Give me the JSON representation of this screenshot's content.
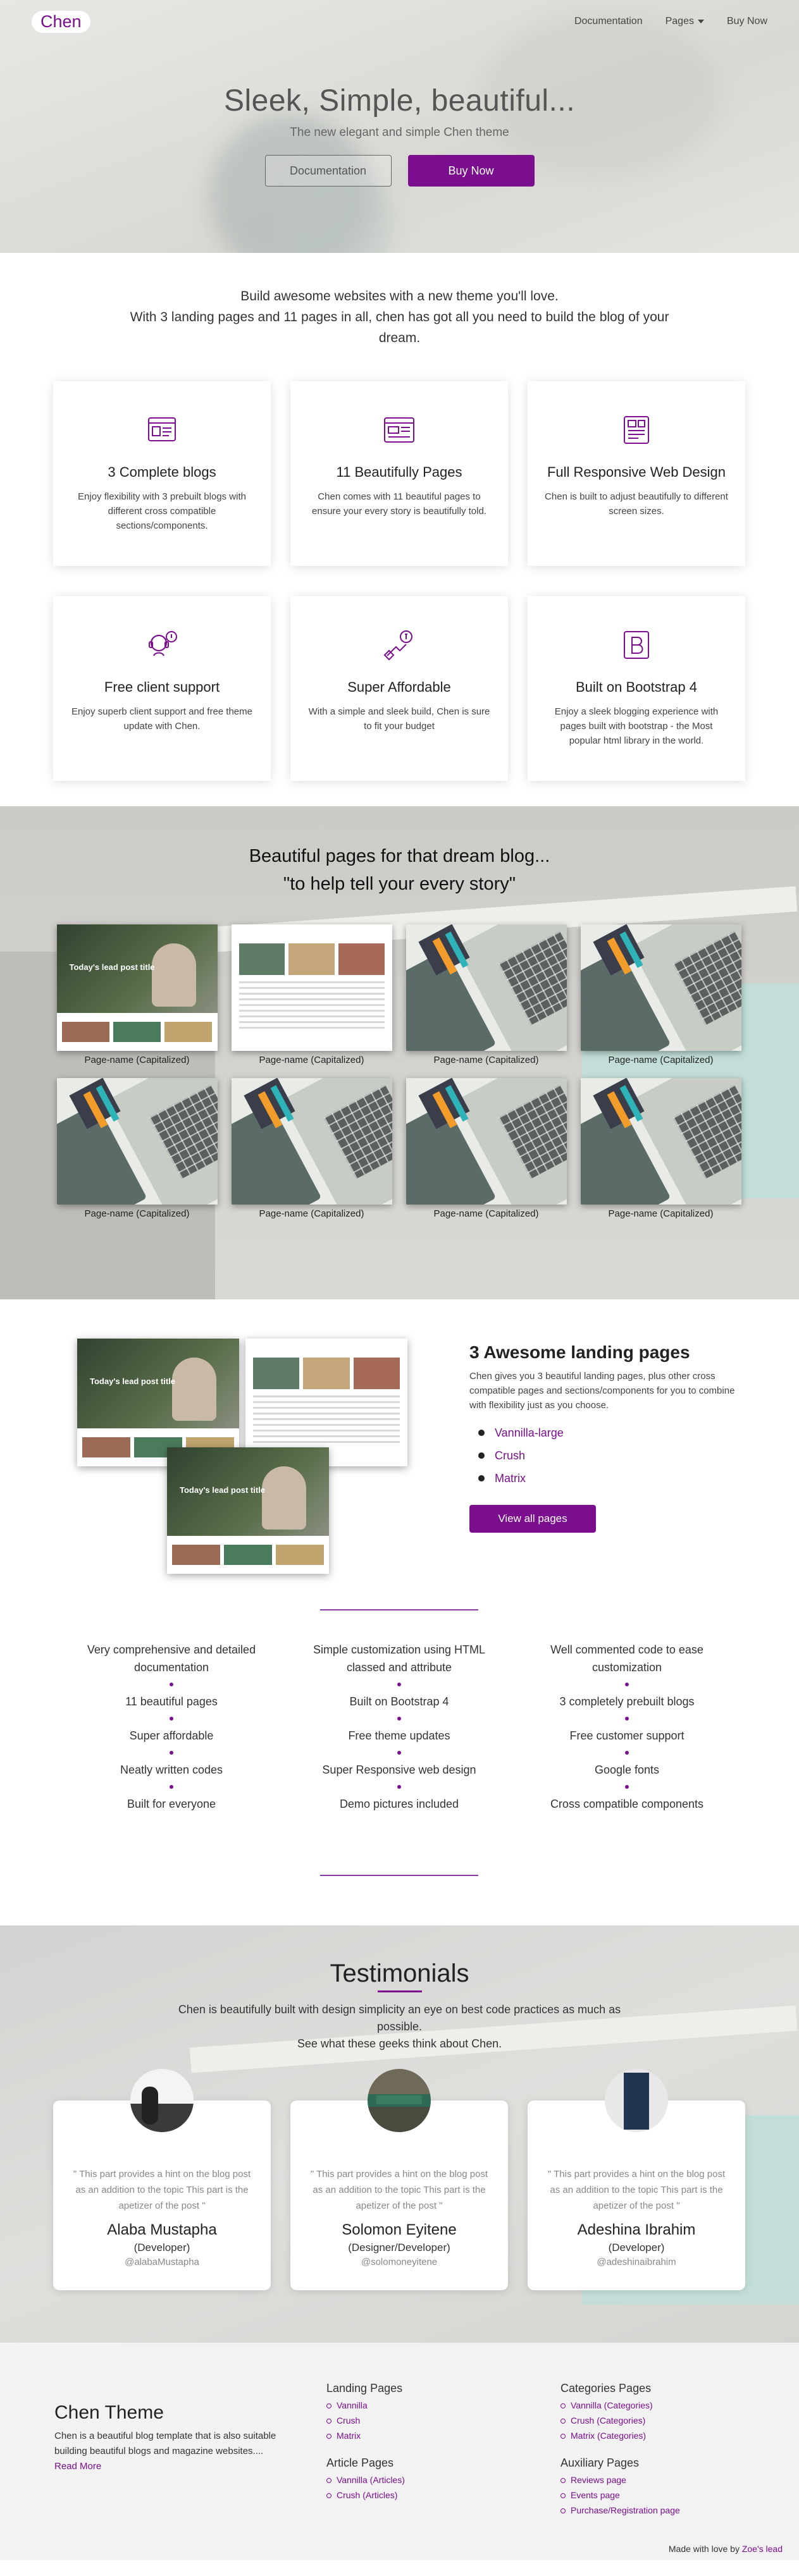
{
  "nav": {
    "brand": "Chen",
    "links": [
      "Documentation",
      "Pages",
      "Buy Now"
    ]
  },
  "hero": {
    "title": "Sleek, Simple, beautiful...",
    "subtitle": "The new elegant and simple Chen theme",
    "btn_docs": "Documentation",
    "btn_buy": "Buy Now"
  },
  "intro": {
    "line1": "Build awesome websites with a new theme you'll love.",
    "line2": "With 3 landing pages and 11 pages in all, chen has got all you need to build the blog of your dream."
  },
  "features": [
    {
      "icon": "blog-layout-icon",
      "title": "3 Complete blogs",
      "text": "Enjoy flexibility with 3 prebuilt blogs with different cross compatible sections/components."
    },
    {
      "icon": "pages-icon",
      "title": "11 Beautifully Pages",
      "text": "Chen comes with 11 beautiful pages to ensure your every story is beautifully told."
    },
    {
      "icon": "responsive-design-icon",
      "title": "Full Responsive Web Design",
      "text": "Chen is built to adjust beautifully to different screen sizes."
    },
    {
      "icon": "support-icon",
      "title": "Free client support",
      "text": "Enjoy superb client support and free theme update with Chen."
    },
    {
      "icon": "affordable-icon",
      "title": "Super Affordable",
      "text": "With a simple and sleek build, Chen is sure to fit your budget"
    },
    {
      "icon": "bootstrap-icon",
      "title": "Built on Bootstrap 4",
      "text": "Enjoy a sleek blogging experience with pages built with bootstrap - the Most popular html library in the world."
    }
  ],
  "gallery": {
    "title1": "Beautiful pages for that dream blog...",
    "title2": "\"to help tell your every story\"",
    "thumbs": [
      {
        "style": "site-dark",
        "caption": "Page-name (Capitalized)",
        "label": "Today's lead post title"
      },
      {
        "style": "site-light",
        "caption": "Page-name (Capitalized)"
      },
      {
        "style": "laptop",
        "caption": "Page-name (Capitalized)"
      },
      {
        "style": "laptop",
        "caption": "Page-name (Capitalized)"
      },
      {
        "style": "laptop",
        "caption": "Page-name (Capitalized)"
      },
      {
        "style": "laptop",
        "caption": "Page-name (Capitalized)"
      },
      {
        "style": "laptop",
        "caption": "Page-name (Capitalized)"
      },
      {
        "style": "laptop",
        "caption": "Page-name (Capitalized)"
      }
    ]
  },
  "landing": {
    "title": "3 Awesome landing pages",
    "text": "Chen gives you 3 beautiful landing pages, plus other cross compatible pages and sections/components for you to combine with flexibility just as you choose.",
    "items": [
      "Vannilla-large",
      "Crush",
      "Matrix"
    ],
    "button": "View all pages",
    "shot_title": "Today's lead post title"
  },
  "feature_list": {
    "col1": [
      "Very comprehensive and detailed documentation",
      "11 beautiful pages",
      "Super affordable",
      "Neatly written codes",
      "Built for everyone"
    ],
    "col2": [
      "Simple customization using HTML classed and attribute",
      "Built on Bootstrap 4",
      "Free theme updates",
      "Super Responsive web design",
      "Demo pictures included"
    ],
    "col3": [
      "Well commented code to ease customization",
      "3 completely prebuilt blogs",
      "Free customer support",
      "Google fonts",
      "Cross compatible components"
    ]
  },
  "testimonials": {
    "title": "Testimonials",
    "lead1": "Chen is beautifully built with design simplicity an eye on best code practices as much as possible.",
    "lead2": "See what these geeks think about Chen.",
    "cards": [
      {
        "quote": "\" This part provides a hint on the blog post as an addition to the topic This part is the apetizer of the post \"",
        "name": "Alaba Mustapha",
        "role": "(Developer)",
        "handle": "@alabaMustapha"
      },
      {
        "quote": "\" This part provides a hint on the blog post as an addition to the topic This part is the apetizer of the post \"",
        "name": "Solomon Eyitene",
        "role": "(Designer/Developer)",
        "handle": "@solomoneyitene"
      },
      {
        "quote": "\" This part provides a hint on the blog post as an addition to the topic This part is the apetizer of the post \"",
        "name": "Adeshina Ibrahim",
        "role": "(Developer)",
        "handle": "@adeshinaibrahim"
      }
    ]
  },
  "footer": {
    "theme_title": "Chen Theme",
    "theme_text": "Chen is a beautiful blog template that is also suitable building beautiful blogs and magazine websites....",
    "read_more": "Read More",
    "landing_title": "Landing Pages",
    "landing_items": [
      "Vannilla",
      "Crush",
      "Matrix"
    ],
    "article_title": "Article Pages",
    "article_items": [
      "Vannilla (Articles)",
      "Crush (Articles)"
    ],
    "categories_title": "Categories Pages",
    "categories_items": [
      "Vannilla (Categories)",
      "Crush (Categories)",
      "Matrix (Categories)"
    ],
    "aux_title": "Auxiliary Pages",
    "aux_items": [
      "Reviews page",
      "Events page",
      "Purchase/Registration page"
    ],
    "made_with": "Made with love by",
    "author": "Zoe's lead"
  },
  "colors": {
    "accent": "#7b0e8f"
  }
}
